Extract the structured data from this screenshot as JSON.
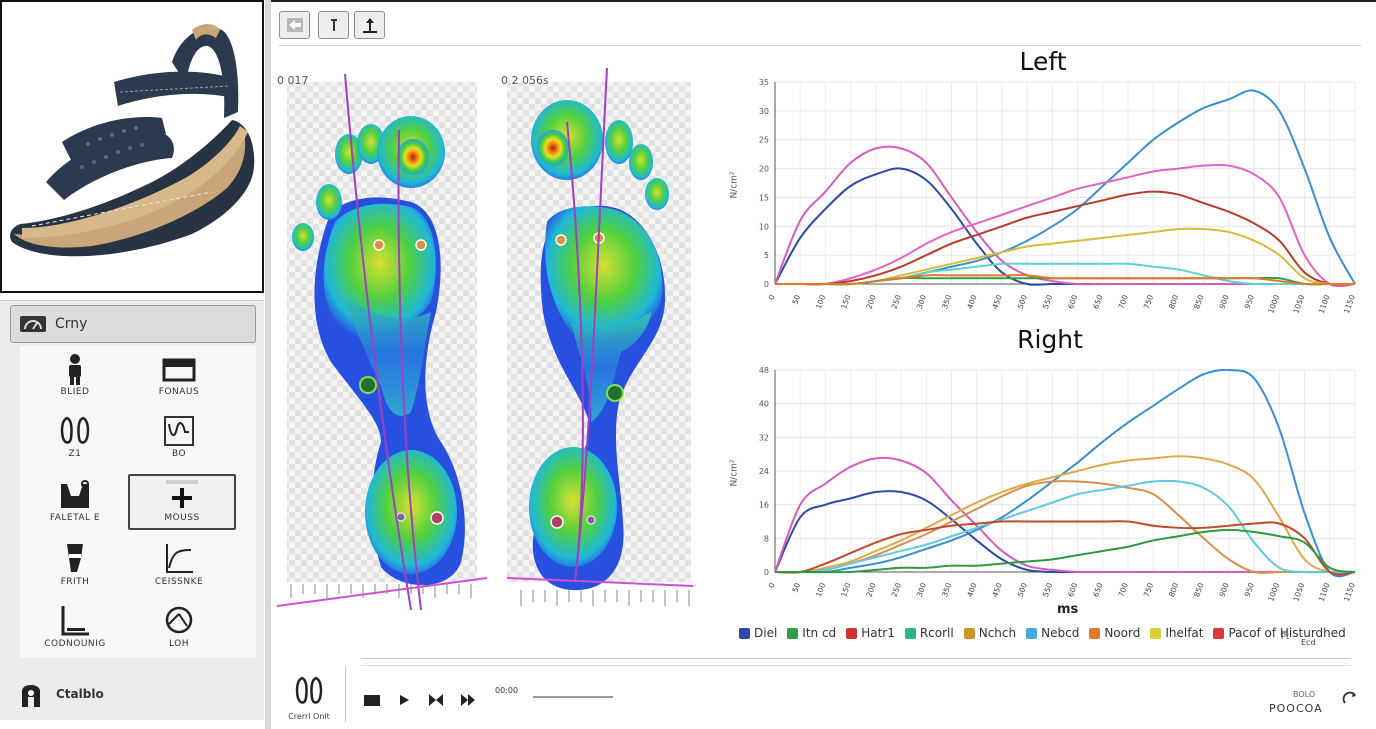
{
  "tools": {
    "header_label": "Crny",
    "items": [
      {
        "label": "BLIED",
        "icon": "figure-icon"
      },
      {
        "label": "FONAUS",
        "icon": "window-icon"
      },
      {
        "label": "Z1",
        "icon": "feet-icon"
      },
      {
        "label": "BO",
        "icon": "curve-box-icon"
      },
      {
        "label": "FALETAL E",
        "icon": "pressure-bar-icon"
      },
      {
        "label": "MOUSS",
        "icon": "plus-icon"
      },
      {
        "label": "FRITH",
        "icon": "leg-icon"
      },
      {
        "label": "CEISSNKE",
        "icon": "curve-icon"
      },
      {
        "label": "CODNOUNIG",
        "icon": "corner-icon"
      },
      {
        "label": "LOH",
        "icon": "target-icon"
      }
    ],
    "footer_label": "Ctalblo"
  },
  "toolbar": {
    "buttons": [
      {
        "icon": "back-icon"
      },
      {
        "icon": "info-icon"
      },
      {
        "icon": "upload-icon"
      }
    ]
  },
  "pressure": {
    "left_label": "0 017",
    "right_label": "0 2 056s"
  },
  "charts": {
    "left_title": "Left",
    "right_title": "Right",
    "left_ylabel": "N/cm²",
    "right_ylabel": "N/cm²",
    "xlabel": "ms",
    "left_yticks": [
      "0",
      "5",
      "10",
      "15",
      "20",
      "25",
      "30",
      "35"
    ],
    "right_yticks": [
      "0",
      "8",
      "16",
      "24",
      "32",
      "40",
      "48"
    ],
    "xticks": [
      "0",
      "50",
      "100",
      "150",
      "200",
      "250",
      "300",
      "350",
      "400",
      "450",
      "500",
      "550",
      "600",
      "650",
      "700",
      "750",
      "800",
      "850",
      "900",
      "950",
      "1000",
      "1050",
      "1100",
      "1150"
    ]
  },
  "legend": [
    {
      "label": "Diel",
      "color": "#2c4aa8"
    },
    {
      "label": "Itn cd",
      "color": "#2ea043"
    },
    {
      "label": "Hatr1",
      "color": "#cc3333"
    },
    {
      "label": "Rcorll",
      "color": "#2bb38a"
    },
    {
      "label": "Nchch",
      "color": "#c8962a"
    },
    {
      "label": "Nebcd",
      "color": "#4aa8e0"
    },
    {
      "label": "Noord",
      "color": "#e07a2a"
    },
    {
      "label": "Ihelfat",
      "color": "#d6cf3a"
    },
    {
      "label": "Pacof of Histurdhed",
      "color": "#d83a3a"
    }
  ],
  "player": {
    "icon_label": "Crerrl Onlt",
    "time": "00:00",
    "status": "POOCOA",
    "status_small": "BOLO",
    "side_note1": "Pt",
    "side_note2": "Ecd"
  },
  "chart_data": [
    {
      "type": "line",
      "title": "Left",
      "xlabel": "",
      "ylabel": "",
      "ylim": [
        0,
        35
      ],
      "x": [
        0,
        50,
        100,
        150,
        200,
        250,
        300,
        350,
        400,
        450,
        500,
        550,
        600,
        650,
        700,
        750,
        800,
        850,
        900,
        950,
        1000,
        1050,
        1100,
        1150
      ],
      "series": [
        {
          "color": "#2c4aa8",
          "values": [
            0,
            8,
            13,
            17,
            19,
            20,
            18,
            13,
            7,
            2,
            0,
            0,
            0,
            0,
            0,
            0,
            0,
            0,
            0,
            0,
            0,
            0,
            0,
            0
          ]
        },
        {
          "color": "#d85cc0",
          "values": [
            0,
            11,
            16,
            21,
            23.5,
            23.5,
            21,
            15,
            9,
            4,
            1.5,
            0.5,
            0,
            0,
            0,
            0,
            0,
            0,
            0,
            0,
            0,
            0,
            0,
            0
          ]
        },
        {
          "color": "#3a8fd0",
          "values": [
            0,
            0,
            0,
            0,
            0.5,
            1,
            2,
            3,
            4,
            5.5,
            7.5,
            10,
            13,
            17,
            21,
            25,
            28,
            30.5,
            32,
            33.5,
            30,
            20,
            8,
            0
          ]
        },
        {
          "color": "#e262c8",
          "values": [
            0,
            0,
            0,
            1,
            2.5,
            4.5,
            7,
            9,
            10.5,
            12,
            13.5,
            15,
            16.5,
            17.5,
            18.5,
            19.5,
            20,
            20.5,
            20.5,
            19,
            15,
            5,
            0,
            0
          ]
        },
        {
          "color": "#b83a2a",
          "values": [
            0,
            0,
            0,
            0.5,
            1.5,
            3,
            5,
            7,
            8.5,
            10,
            11.5,
            12.5,
            13.5,
            14.5,
            15.5,
            16,
            15.5,
            14,
            12.5,
            10.5,
            7.5,
            2,
            0,
            0
          ]
        },
        {
          "color": "#d6bc3a",
          "values": [
            0,
            0,
            0,
            0,
            0.5,
            1.5,
            2.5,
            3.5,
            4.5,
            5.5,
            6.5,
            7,
            7.5,
            8,
            8.5,
            9,
            9.5,
            9.5,
            9,
            7.5,
            5,
            1,
            0,
            0
          ]
        },
        {
          "color": "#5fd0d8",
          "values": [
            0,
            0,
            0,
            0,
            0.5,
            1,
            2,
            2.5,
            3,
            3.5,
            3.5,
            3.5,
            3.5,
            3.5,
            3.5,
            3,
            2.5,
            1.5,
            0.5,
            0,
            0,
            0,
            0,
            0
          ]
        },
        {
          "color": "#2ea043",
          "values": [
            0,
            0,
            0,
            0,
            0.5,
            1,
            1,
            1,
            1,
            1,
            1,
            1,
            1,
            1,
            1,
            1,
            1,
            1,
            1,
            1,
            1,
            0,
            0,
            0
          ]
        },
        {
          "color": "#e07a2a",
          "values": [
            0,
            0,
            0,
            0,
            0.5,
            1,
            1.5,
            1.5,
            1.5,
            1.5,
            1.5,
            1,
            1,
            1,
            1,
            1,
            1,
            1,
            1,
            1,
            0.5,
            0,
            0,
            0
          ]
        }
      ]
    },
    {
      "type": "line",
      "title": "Right",
      "xlabel": "ms",
      "ylabel": "",
      "ylim": [
        0,
        48
      ],
      "x": [
        0,
        50,
        100,
        150,
        200,
        250,
        300,
        350,
        400,
        450,
        500,
        550,
        600,
        650,
        700,
        750,
        800,
        850,
        900,
        950,
        1000,
        1050,
        1100,
        1150
      ],
      "series": [
        {
          "color": "#2c4aa8",
          "values": [
            0,
            13,
            16,
            17.5,
            19,
            19,
            17,
            12.5,
            7.5,
            3,
            0.5,
            0,
            0,
            0,
            0,
            0,
            0,
            0,
            0,
            0,
            0,
            0,
            0,
            0
          ]
        },
        {
          "color": "#d85cc0",
          "values": [
            0,
            16,
            21,
            25,
            27,
            26.5,
            23.5,
            17,
            11,
            5,
            1.5,
            0.5,
            0,
            0,
            0,
            0,
            0,
            0,
            0,
            0,
            0,
            0,
            0,
            0
          ]
        },
        {
          "color": "#3a8fd0",
          "values": [
            0,
            0,
            0,
            1,
            2,
            3.5,
            5.5,
            7.5,
            10,
            13,
            17,
            21.5,
            26,
            31,
            35.5,
            39.5,
            43.5,
            47,
            48,
            46,
            34,
            14,
            0,
            0
          ]
        },
        {
          "color": "#e0a84a",
          "values": [
            0,
            0,
            1,
            2.5,
            5,
            7.5,
            10.5,
            13.5,
            16.5,
            19,
            21,
            22.5,
            24,
            25.5,
            26.5,
            27,
            27.5,
            27,
            25.5,
            22,
            13,
            3,
            0,
            0
          ]
        },
        {
          "color": "#d6904a",
          "values": [
            0,
            0,
            0.5,
            2,
            4,
            6.5,
            9,
            12,
            15,
            18,
            20.5,
            21.5,
            21.5,
            21,
            20,
            18.5,
            13.5,
            8,
            3,
            0,
            0,
            0,
            0,
            0
          ]
        },
        {
          "color": "#5fc8e0",
          "values": [
            0,
            0,
            0.5,
            2,
            3.5,
            5,
            6.5,
            8.5,
            10.5,
            12.5,
            14.5,
            16.5,
            18.5,
            19.5,
            20.5,
            21.5,
            21.5,
            20,
            15.5,
            7,
            1,
            0,
            0,
            0
          ]
        },
        {
          "color": "#c04a2a",
          "values": [
            0,
            0,
            2,
            4.5,
            7,
            9,
            10,
            11,
            11.5,
            12,
            12,
            12,
            12,
            12,
            12,
            11,
            10.5,
            10.5,
            11,
            11.5,
            11.5,
            8,
            0,
            0
          ]
        },
        {
          "color": "#2e9a3e",
          "values": [
            0,
            0,
            0,
            0,
            0.5,
            1,
            1,
            1.5,
            1.5,
            2,
            2.5,
            3,
            4,
            5,
            6,
            7.5,
            8.5,
            9.5,
            10,
            9.5,
            8.5,
            7,
            1,
            0
          ]
        }
      ]
    }
  ]
}
